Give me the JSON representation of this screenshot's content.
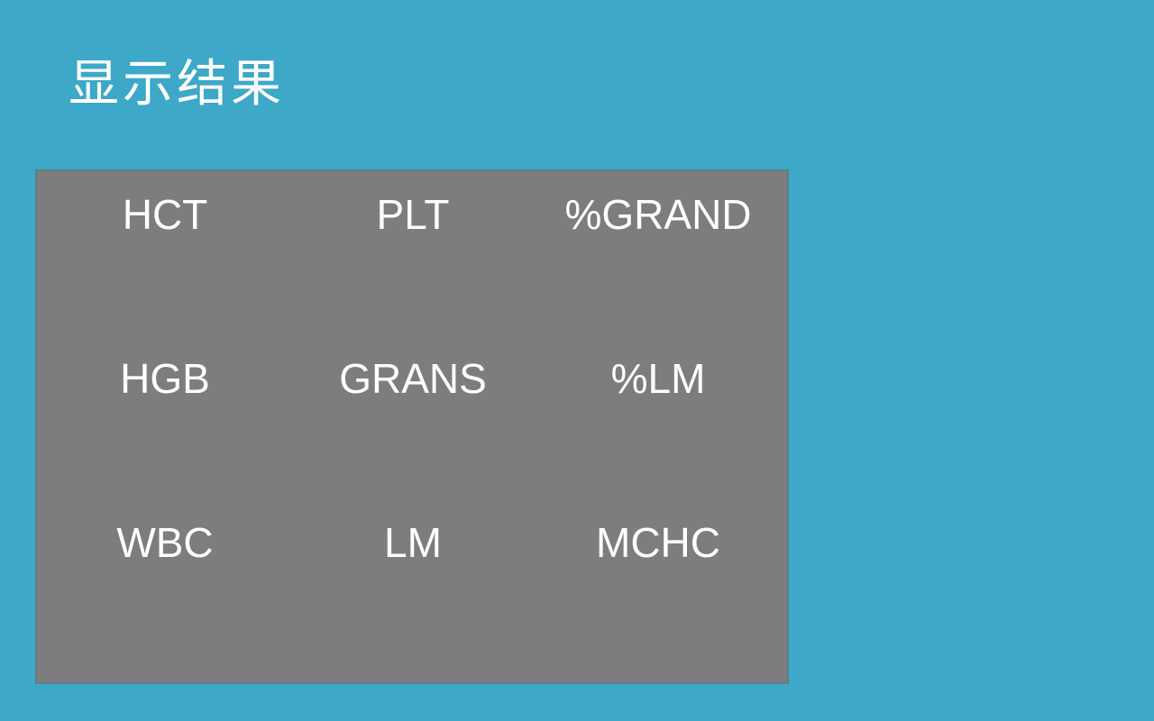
{
  "page": {
    "title": "显示结果"
  },
  "results": {
    "rows": [
      [
        "HCT",
        "PLT",
        "%GRAND"
      ],
      [
        "HGB",
        "GRANS",
        "%LM"
      ],
      [
        "WBC",
        "LM",
        "MCHC"
      ]
    ]
  },
  "colors": {
    "background": "#3da8c8",
    "panel": "#7d7d7d",
    "text": "#ffffff"
  }
}
